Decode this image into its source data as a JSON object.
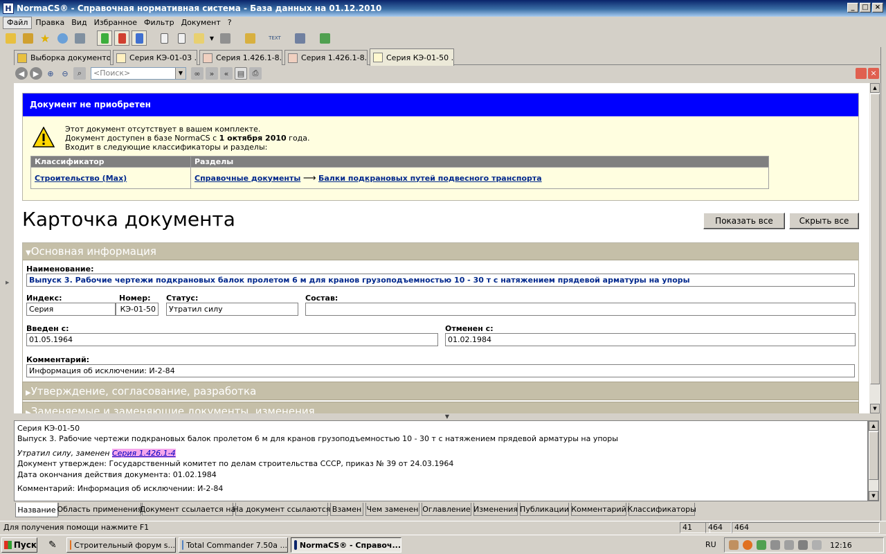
{
  "window": {
    "title": "NormaCS® - Справочная нормативная система - База данных на 01.12.2010",
    "app_icon": "H"
  },
  "menu": [
    "Файл",
    "Правка",
    "Вид",
    "Избранное",
    "Фильтр",
    "Документ",
    "?"
  ],
  "tabs": [
    "Выборка документов",
    "Серия КЭ-01-03 ...",
    "Серия 1.426.1-8...",
    "Серия 1.426.1-8...",
    "Серия КЭ-01-50 ..."
  ],
  "search": {
    "placeholder": "<Поиск>"
  },
  "notice": {
    "header": "Документ не приобретен",
    "line1": "Этот документ отсутствует в вашем комплекте.",
    "line2_prefix": "Документ доступен в базе NormaCS с ",
    "line2_date": "1 октября 2010",
    "line2_suffix": " года.",
    "line3": "Входит в следующие классификаторы и разделы:",
    "col1": "Классификатор",
    "col2": "Разделы",
    "classifier": "Строительство (Max)",
    "section1": "Справочные документы",
    "arrow": "⟶",
    "section2": "Балки подкрановых путей подвесного транспорта"
  },
  "card": {
    "title": "Карточка документа",
    "show_all": "Показать все",
    "hide_all": "Скрыть все",
    "section_main": "Основная информация",
    "name_label": "Наименование:",
    "name_value": "Выпуск 3. Рабочие чертежи подкрановых балок пролетом 6 м для кранов грузоподъемностью 10 - 30 т с натяжением прядевой арматуры на упоры",
    "index_label": "Индекс:",
    "index_value": "Серия",
    "number_label": "Номер:",
    "number_value": "КЭ-01-50",
    "status_label": "Статус:",
    "status_value": "Утратил силу",
    "composition_label": "Состав:",
    "composition_value": "",
    "introduced_label": "Введен с:",
    "introduced_value": "01.05.1964",
    "cancelled_label": "Отменен с:",
    "cancelled_value": "01.02.1984",
    "comment_label": "Комментарий:",
    "comment_value": "Информация об исключении: И-2-84",
    "section_approval": "Утверждение, согласование, разработка",
    "section_replaced": "Заменяемые и заменяющие документы, изменения"
  },
  "bottom": {
    "line1": "Серия КЭ-01-50",
    "line2": "Выпуск 3. Рабочие чертежи подкрановых балок пролетом 6 м для кранов грузоподъемностью 10 - 30 т с натяжением прядевой арматуры на упоры",
    "lost_prefix": "Утратил силу, заменен ",
    "lost_link": "Серия 1.426.1-4",
    "approved": "Документ утвержден: Государственный комитет по делам строительства СССР, приказ № 39 от 24.03.1964",
    "end_date": "Дата окончания действия документа: 01.02.1984",
    "comment": "Комментарий: Информация об исключении: И-2-84"
  },
  "bottom_tabs": [
    "Название",
    "Область применения",
    "Документ ссылается на",
    "На документ ссылаются",
    "Взамен",
    "Чем заменен",
    "Оглавление",
    "Изменения",
    "Публикации",
    "Комментарий",
    "Классификаторы"
  ],
  "status": {
    "help": "Для получения помощи нажмите F1",
    "p1": "41",
    "p2": "464",
    "p3": "464"
  },
  "taskbar": {
    "start": "Пуск",
    "tasks": [
      "Строительный форум s...",
      "Total Commander 7.50a ...",
      "NormaCS® - Справоч..."
    ],
    "lang": "RU",
    "clock": "12:16"
  },
  "colors": {
    "notice_header": "#0000ff",
    "link": "#00288c",
    "section_header": "#c5bfa8",
    "link_highlight": "#f5a6ec"
  }
}
